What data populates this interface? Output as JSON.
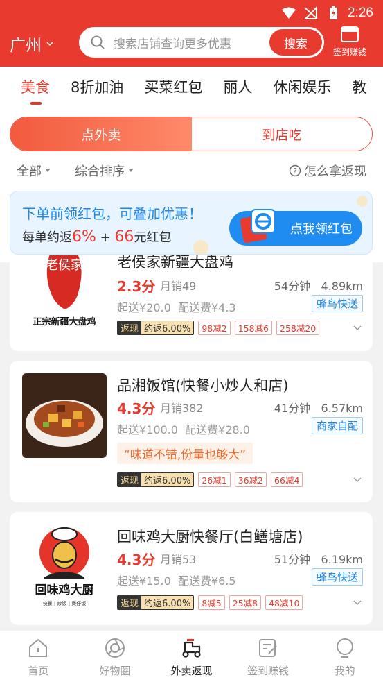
{
  "status_bar": {
    "time": "2:26"
  },
  "header": {
    "city": "广州",
    "search_placeholder": "搜索店铺查询更多优惠",
    "search_button": "搜索",
    "signin_label": "签到赚钱"
  },
  "categories": [
    "美食",
    "8折加油",
    "买菜红包",
    "丽人",
    "休闲娱乐",
    "教"
  ],
  "segments": {
    "active": "点外卖",
    "inactive": "到店吃"
  },
  "filters": {
    "all": "全部",
    "sort": "综合排序",
    "help": "怎么拿返现"
  },
  "promo": {
    "title": "下单前领红包，可叠加优惠！",
    "line_prefix": "每单约返",
    "percent": "6%",
    "plus": " + ",
    "amount": "66",
    "line_suffix": "元红包",
    "button": "点我领红包"
  },
  "stores": [
    {
      "name": "老侯家新疆大盘鸡",
      "logo_text": "老侯家",
      "logo_sub": "正宗新疆大盘鸡",
      "score": "2.3分",
      "sales": "月销49",
      "time": "54分钟",
      "distance": "4.89km",
      "min_order": "起送¥20.0",
      "delivery_fee": "配送费¥4.3",
      "delivery_type": "蜂鸟快送",
      "cashback_label": "返现",
      "cashback_rate": "约返6.00%",
      "discounts": [
        "98减2",
        "158减6",
        "258减20"
      ]
    },
    {
      "name": "品湘饭馆(快餐小炒人和店)",
      "score": "4.3分",
      "sales": "月销382",
      "time": "41分钟",
      "distance": "6.57km",
      "min_order": "起送¥100.0",
      "delivery_fee": "配送费¥28.0",
      "delivery_type": "商家自配",
      "quote": "“味道不错,份量也够大”",
      "cashback_label": "返现",
      "cashback_rate": "约返6.00%",
      "discounts": [
        "26减1",
        "36减2",
        "66减4"
      ]
    },
    {
      "name": "回味鸡大厨快餐厅(白鳝塘店)",
      "logo_text": "回味鸡大厨",
      "logo_sub": "快餐 | 炒饭 | 煲仔饭",
      "score": "4.3分",
      "sales": "月销53",
      "time": "51分钟",
      "distance": "6.19km",
      "min_order": "起送¥15.0",
      "delivery_fee": "配送费¥6.5",
      "delivery_type": "蜂鸟快送",
      "cashback_label": "返现",
      "cashback_rate": "约返6.00%",
      "discounts": [
        "8减5",
        "25减8",
        "48减10"
      ]
    }
  ],
  "bottom_nav": [
    {
      "label": "首页",
      "icon": "home-icon"
    },
    {
      "label": "好物圈",
      "icon": "camera-icon"
    },
    {
      "label": "外卖返现",
      "icon": "scooter-icon"
    },
    {
      "label": "签到赚钱",
      "icon": "checkin-icon"
    },
    {
      "label": "我的",
      "icon": "profile-icon"
    }
  ],
  "colors": {
    "brand_red": "#e93a2f",
    "promo_blue": "#1f8cf2"
  }
}
